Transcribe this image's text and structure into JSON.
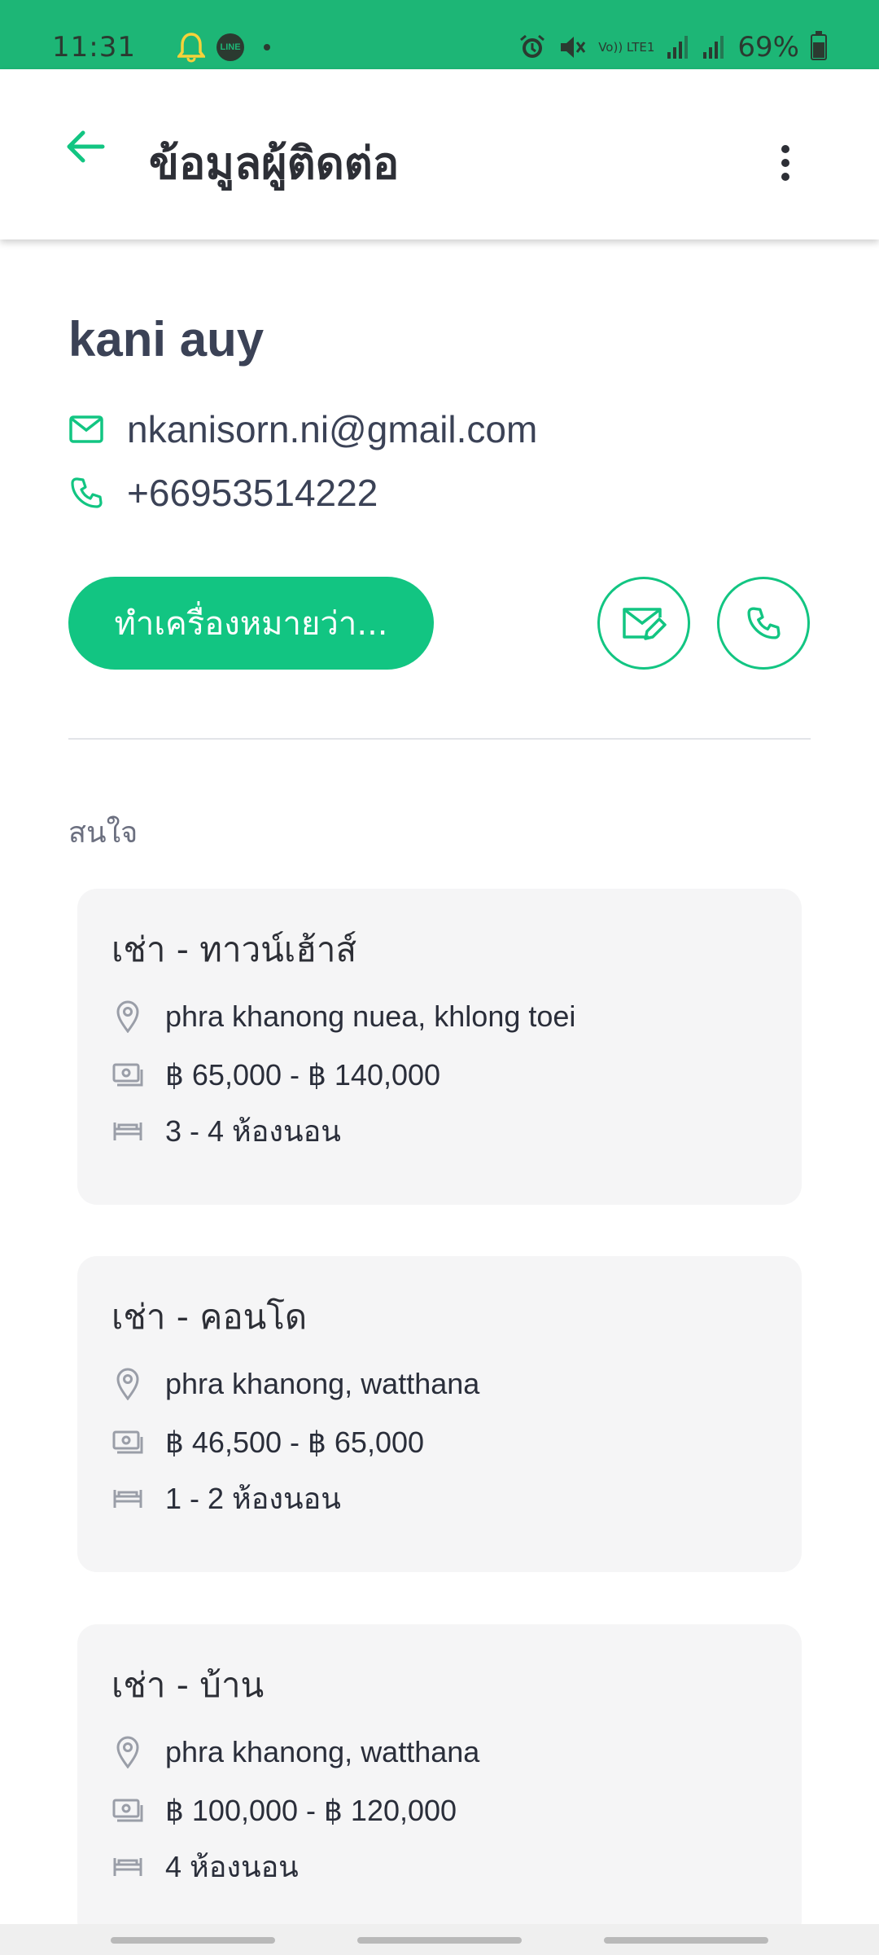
{
  "status_bar": {
    "time": "11:31",
    "battery": "69%",
    "network_label": "Vo)) LTE1",
    "battery_level": 0.69,
    "left_icons": [
      "bell-icon",
      "line-app-icon",
      "dot-icon"
    ],
    "right_icons": [
      "alarm-icon",
      "mute-icon",
      "volte-icon",
      "signal-icon",
      "signal-icon",
      "battery-icon"
    ],
    "line_label": "LINE"
  },
  "app_bar": {
    "title": "ข้อมูลผู้ติดต่อ",
    "back_icon": "arrow-left-icon",
    "menu_icon": "more-vert-icon"
  },
  "contact": {
    "name": "kani auy",
    "email": "nkanisorn.ni@gmail.com",
    "phone": "+66953514222"
  },
  "actions": {
    "primary_label": "ทำเครื่องหมายว่า...",
    "email_icon": "email-edit-icon",
    "call_icon": "phone-icon"
  },
  "interests": {
    "label": "สนใจ",
    "items": [
      {
        "title": "เช่า - ทาวน์เฮ้าส์",
        "location": "phra khanong nuea, khlong toei",
        "price": "฿ 65,000 - ฿ 140,000",
        "bedrooms": "3 - 4 ห้องนอน"
      },
      {
        "title": "เช่า - คอนโด",
        "location": "phra khanong, watthana",
        "price": "฿ 46,500 - ฿ 65,000",
        "bedrooms": "1 - 2 ห้องนอน"
      },
      {
        "title": "เช่า - บ้าน",
        "location": "phra khanong, watthana",
        "price": "฿ 100,000 - ฿ 120,000",
        "bedrooms": "4 ห้องนอน"
      }
    ]
  },
  "colors": {
    "status_bar": "#1db676",
    "accent": "#12c582",
    "card_bg": "#f5f5f6",
    "text_primary": "#3b4256"
  }
}
